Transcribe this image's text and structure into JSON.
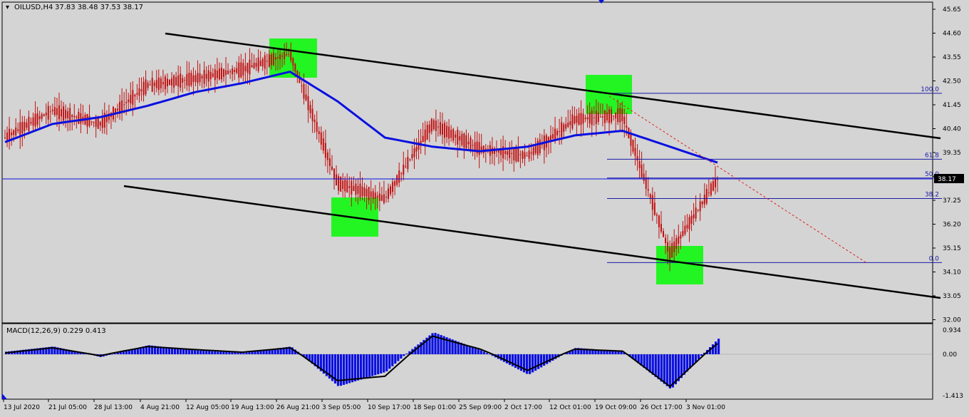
{
  "header": {
    "symbol": "OILUSD,H4",
    "ohlc": "37.83 38.48 37.53 38.17"
  },
  "price_axis": {
    "labels": [
      "45.65",
      "44.60",
      "43.55",
      "42.50",
      "41.45",
      "40.40",
      "39.35",
      "38.30",
      "37.25",
      "36.20",
      "35.15",
      "34.10",
      "33.05",
      "32.00"
    ],
    "current_price": "38.17"
  },
  "time_axis": {
    "labels": [
      "13 Jul 2020",
      "21 Jul 05:00",
      "28 Jul 13:00",
      "4 Aug 21:00",
      "12 Aug 05:00",
      "19 Aug 13:00",
      "26 Aug 21:00",
      "3 Sep 05:00",
      "10 Sep 17:00",
      "18 Sep 01:00",
      "25 Sep 09:00",
      "2 Oct 17:00",
      "12 Oct 01:00",
      "19 Oct 09:00",
      "26 Oct 17:00",
      "3 Nov 01:00"
    ]
  },
  "fibonacci": {
    "levels": [
      "100.0",
      "61.8",
      "50.0",
      "38.2",
      "0.0"
    ]
  },
  "macd_panel": {
    "title": "MACD(12,26,9) 0.229 0.413",
    "axis_labels": [
      "0.934",
      "0.00",
      "-1.413"
    ]
  },
  "colors": {
    "background": "#d4d4d4",
    "moving_average": "#0a10e0",
    "candles": "#c11010",
    "highlight_boxes": "#23f523",
    "fib_lines": "#1a1aa8",
    "channel": "#000000",
    "macd_histogram": "#0a10e0",
    "macd_signal": "#000000",
    "projection": "#e02020"
  },
  "chart_data": [
    {
      "type": "candlestick",
      "title": "OILUSD,H4",
      "x": [
        "13 Jul 2020",
        "21 Jul 05:00",
        "28 Jul 13:00",
        "4 Aug 21:00",
        "12 Aug 05:00",
        "19 Aug 13:00",
        "26 Aug 21:00",
        "3 Sep 05:00",
        "10 Sep 17:00",
        "18 Sep 01:00",
        "25 Sep 09:00",
        "2 Oct 17:00",
        "12 Oct 01:00",
        "19 Oct 09:00",
        "26 Oct 17:00",
        "3 Nov 01:00"
      ],
      "close": [
        40.0,
        41.2,
        40.6,
        42.3,
        42.6,
        43.0,
        43.7,
        38.0,
        37.3,
        40.6,
        39.5,
        39.2,
        40.8,
        41.0,
        34.9,
        38.17
      ],
      "moving_average": [
        39.8,
        40.6,
        40.9,
        41.4,
        42.0,
        42.4,
        42.9,
        41.6,
        40.0,
        39.6,
        39.4,
        39.6,
        40.1,
        40.3,
        39.6,
        38.9
      ],
      "ylim": [
        32.0,
        46.0
      ],
      "fib_levels": {
        "100.0": 41.95,
        "61.8": 39.05,
        "50.0": 38.22,
        "38.2": 37.32,
        "0.0": 34.5
      },
      "current_price": 38.17
    },
    {
      "type": "bar",
      "title": "MACD(12,26,9)",
      "x": [
        "13 Jul 2020",
        "21 Jul 05:00",
        "28 Jul 13:00",
        "4 Aug 21:00",
        "12 Aug 05:00",
        "19 Aug 13:00",
        "26 Aug 21:00",
        "3 Sep 05:00",
        "10 Sep 17:00",
        "18 Sep 01:00",
        "25 Sep 09:00",
        "2 Oct 17:00",
        "12 Oct 01:00",
        "19 Oct 09:00",
        "26 Oct 17:00",
        "3 Nov 01:00"
      ],
      "macd": [
        0.1,
        0.3,
        -0.1,
        0.35,
        0.15,
        0.05,
        0.3,
        -1.1,
        -0.6,
        0.85,
        0.15,
        -0.7,
        0.25,
        0.1,
        -1.2,
        0.6
      ],
      "signal": [
        0.05,
        0.25,
        -0.05,
        0.3,
        0.18,
        0.08,
        0.25,
        -0.9,
        -0.75,
        0.7,
        0.2,
        -0.55,
        0.2,
        0.12,
        -1.1,
        0.41
      ],
      "ylim": [
        -1.413,
        0.934
      ]
    }
  ]
}
